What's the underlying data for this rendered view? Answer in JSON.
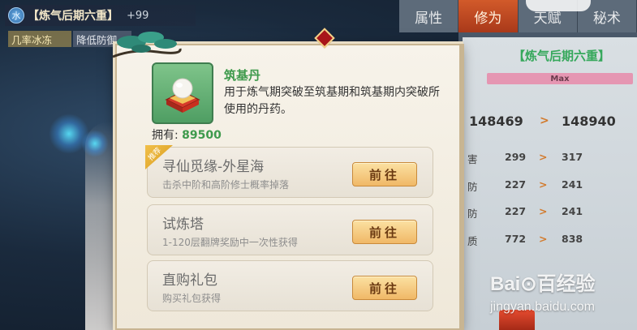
{
  "header": {
    "element_badge": "水",
    "realm_name": "【炼气后期六重】",
    "realm_bonus": "+99",
    "tags": [
      "几率冰冻",
      "降低防御"
    ]
  },
  "side_panel": {
    "tabs": [
      {
        "label": "属性",
        "active": false
      },
      {
        "label": "修为",
        "active": true
      },
      {
        "label": "天赋",
        "active": false
      },
      {
        "label": "秘术",
        "active": false
      }
    ],
    "rank_title": "【炼气后期六重】",
    "max_label": "Max",
    "main_stat": {
      "current": "148469",
      "next": "148940"
    },
    "stats": [
      {
        "label": "害",
        "current": "299",
        "next": "317"
      },
      {
        "label": "防",
        "current": "227",
        "next": "241"
      },
      {
        "label": "防",
        "current": "227",
        "next": "241"
      },
      {
        "label": "质",
        "current": "772",
        "next": "838"
      }
    ],
    "arrow": ">"
  },
  "modal": {
    "item_name": "筑基丹",
    "item_description": "用于炼气期突破至筑基期和筑基期内突破所使用的丹药。",
    "owned_label": "拥有:",
    "owned_count": "89500",
    "sources": [
      {
        "title": "寻仙觅缘-外星海",
        "subtitle": "击杀中阶和高阶修士概率掉落",
        "button": "前往",
        "recommended": true,
        "recommend_label": "推荐"
      },
      {
        "title": "试炼塔",
        "subtitle": "1-120层翻牌奖励中一次性获得",
        "button": "前往",
        "recommended": false
      },
      {
        "title": "直购礼包",
        "subtitle": "购买礼包获得",
        "button": "前往",
        "recommended": false
      }
    ]
  },
  "watermark": {
    "logo": "Bai⊙百经验",
    "url": "jingyan.baidu.com"
  },
  "colors": {
    "accent_green": "#3e9a4c",
    "active_tab": "#c2441f",
    "button_gold": "#f0b867"
  }
}
